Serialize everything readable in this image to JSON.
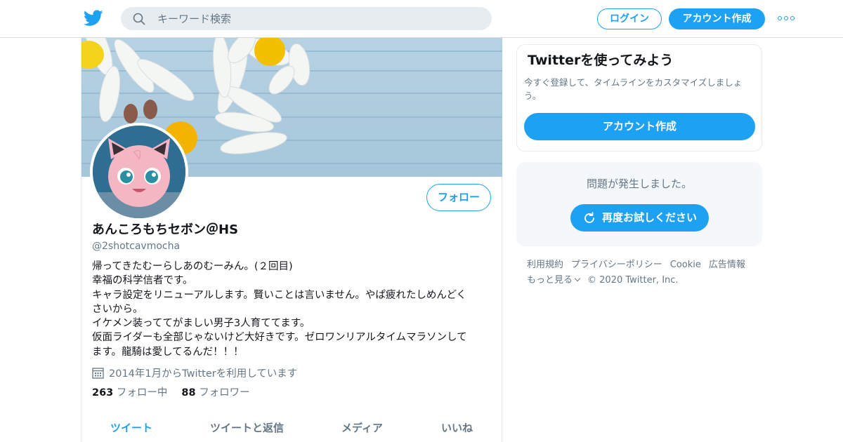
{
  "header": {
    "logo_icon": "twitter-bird-icon",
    "search_placeholder": "キーワード検索",
    "login_label": "ログイン",
    "signup_label": "アカウント作成",
    "more_icon": "more-dots-icon",
    "accent_color": "#1da1f2"
  },
  "profile": {
    "display_name": "あんころもちセボン＠HS",
    "handle": "@2shotcavmocha",
    "follow_label": "フォロー",
    "bio_lines": [
      "帰ってきたむーらしあのむーみん。(２回目)",
      "幸福の科学信者です。",
      "キャラ設定をリニューアルします。賢いことは言いません。やぱ疲れたしめんどく",
      "さいから。",
      "イケメン装っててがましい男子3人育ててます。",
      "仮面ライダーも全部じゃないけど大好きです。ゼロワンリアルタイムマラソンして",
      "ます。龍騎は愛してるんだ！！！"
    ],
    "joined_icon": "calendar-icon",
    "joined_text": "2014年1月からTwitterを利用しています",
    "following_count": "263",
    "following_label": "フォロー中",
    "followers_count": "88",
    "followers_label": "フォロワー",
    "tabs": [
      "ツイート",
      "ツイートと返信",
      "メディア",
      "いいね"
    ]
  },
  "sidebar": {
    "signup_card": {
      "title": "Twitterを使ってみよう",
      "text": "今すぐ登録して、タイムラインをカスタマイズしましょう。",
      "button_label": "アカウント作成"
    },
    "error": {
      "message": "問題が発生しました。",
      "retry_label": "再度お試しください",
      "retry_icon": "refresh-icon"
    },
    "footer": {
      "links": [
        "利用規約",
        "プライバシーポリシー",
        "Cookie",
        "広告情報"
      ],
      "more_label": "もっと見る",
      "copyright": "© 2020 Twitter, Inc."
    }
  }
}
